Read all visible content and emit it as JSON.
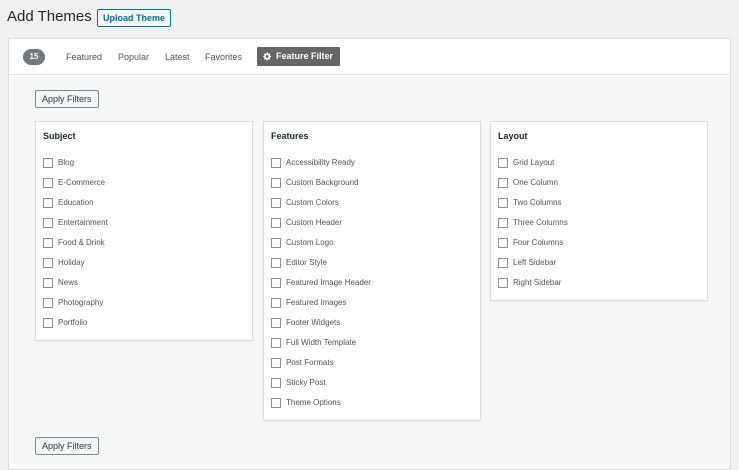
{
  "header": {
    "title": "Add Themes",
    "upload_label": "Upload Theme"
  },
  "filter_bar": {
    "count": "15",
    "tabs": [
      {
        "label": "Featured"
      },
      {
        "label": "Popular"
      },
      {
        "label": "Latest"
      },
      {
        "label": "Favorites"
      }
    ],
    "feature_filter_label": "Feature Filter",
    "feature_filter_icon": "gear-icon"
  },
  "drawer": {
    "apply_top_label": "Apply Filters",
    "apply_bottom_label": "Apply Filters",
    "groups": [
      {
        "title": "Subject",
        "options": [
          "Blog",
          "E-Commerce",
          "Education",
          "Entertainment",
          "Food & Drink",
          "Holiday",
          "News",
          "Photography",
          "Portfolio"
        ]
      },
      {
        "title": "Features",
        "options": [
          "Accessibility Ready",
          "Custom Background",
          "Custom Colors",
          "Custom Header",
          "Custom Logo",
          "Editor Style",
          "Featured Image Header",
          "Featured Images",
          "Footer Widgets",
          "Full Width Template",
          "Post Formats",
          "Sticky Post",
          "Theme Options"
        ]
      },
      {
        "title": "Layout",
        "options": [
          "Grid Layout",
          "One Column",
          "Two Columns",
          "Three Columns",
          "Four Columns",
          "Left Sidebar",
          "Right Sidebar"
        ]
      }
    ]
  },
  "colors": {
    "accent": "#0071a1",
    "active_tab_bg": "#666666",
    "badge_bg": "#72777c"
  }
}
